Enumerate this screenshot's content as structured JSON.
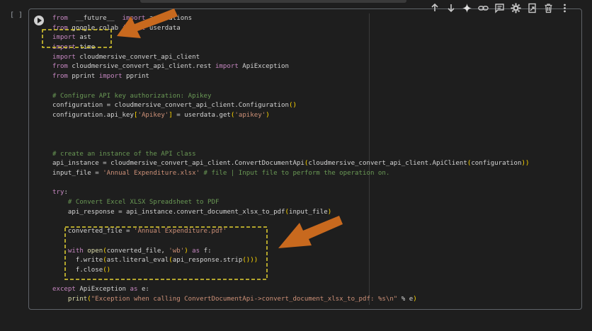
{
  "cell": {
    "execution_count": "[ ]",
    "lines": [
      [
        [
          "kw",
          "from"
        ],
        [
          "",
          "  __future__  "
        ],
        [
          "kw",
          "import"
        ],
        [
          "",
          " annotations"
        ]
      ],
      [
        [
          "kw",
          "from"
        ],
        [
          "",
          " google.colab "
        ],
        [
          "kw",
          "import"
        ],
        [
          "",
          " userdata"
        ]
      ],
      [
        [
          "kw",
          "import"
        ],
        [
          "",
          " ast"
        ]
      ],
      [
        [
          "kw",
          "import"
        ],
        [
          "",
          " time"
        ]
      ],
      [
        [
          "kw",
          "import"
        ],
        [
          "",
          " cloudmersive_convert_api_client"
        ]
      ],
      [
        [
          "kw",
          "from"
        ],
        [
          "",
          " cloudmersive_convert_api_client.rest "
        ],
        [
          "kw",
          "import"
        ],
        [
          "",
          " ApiException"
        ]
      ],
      [
        [
          "kw",
          "from"
        ],
        [
          "",
          " pprint "
        ],
        [
          "kw",
          "import"
        ],
        [
          "",
          " pprint"
        ]
      ],
      [],
      [
        [
          "cm",
          "# Configure API key authorization: Apikey"
        ]
      ],
      [
        [
          "",
          "configuration = cloudmersive_convert_api_client.Configuration"
        ],
        [
          "br",
          "()"
        ]
      ],
      [
        [
          "",
          "configuration.api_key"
        ],
        [
          "br",
          "["
        ],
        [
          "str",
          "'Apikey'"
        ],
        [
          "br",
          "]"
        ],
        [
          "",
          " = userdata.get"
        ],
        [
          "br",
          "("
        ],
        [
          "str",
          "'apikey'"
        ],
        [
          "br",
          ")"
        ]
      ],
      [],
      [],
      [],
      [
        [
          "cm",
          "# create an instance of the API class"
        ]
      ],
      [
        [
          "",
          "api_instance = cloudmersive_convert_api_client.ConvertDocumentApi"
        ],
        [
          "br",
          "("
        ],
        [
          "",
          "cloudmersive_convert_api_client.ApiClient"
        ],
        [
          "br",
          "("
        ],
        [
          "",
          "configuration"
        ],
        [
          "br",
          "))"
        ]
      ],
      [
        [
          "",
          "input_file = "
        ],
        [
          "str",
          "'Annual Expenditure.xlsx'"
        ],
        [
          "cm",
          " # file | Input file to perform the operation on."
        ]
      ],
      [],
      [
        [
          "kw",
          "try"
        ],
        [
          "",
          ":"
        ]
      ],
      [
        [
          "",
          "    "
        ],
        [
          "cm",
          "# Convert Excel XLSX Spreadsheet to PDF"
        ]
      ],
      [
        [
          "",
          "    api_response = api_instance.convert_document_xlsx_to_pdf"
        ],
        [
          "br",
          "("
        ],
        [
          "",
          "input_file"
        ],
        [
          "br",
          ")"
        ]
      ],
      [],
      [
        [
          "",
          "    converted_file = "
        ],
        [
          "str",
          "'Annual Expenditure.pdf'"
        ]
      ],
      [],
      [
        [
          "",
          "    "
        ],
        [
          "kw",
          "with"
        ],
        [
          "",
          " "
        ],
        [
          "fn",
          "open"
        ],
        [
          "br",
          "("
        ],
        [
          "",
          "converted_file, "
        ],
        [
          "str",
          "'wb'"
        ],
        [
          "br",
          ")"
        ],
        [
          "",
          " "
        ],
        [
          "kw",
          "as"
        ],
        [
          "",
          " f:"
        ]
      ],
      [
        [
          "",
          "      f.write"
        ],
        [
          "br",
          "("
        ],
        [
          "",
          "ast.literal_eval"
        ],
        [
          "br",
          "("
        ],
        [
          "",
          "api_response.strip"
        ],
        [
          "br",
          "()))"
        ]
      ],
      [
        [
          "",
          "      f.close"
        ],
        [
          "br",
          "()"
        ]
      ],
      [],
      [
        [
          "kw",
          "except"
        ],
        [
          "",
          " ApiException "
        ],
        [
          "kw",
          "as"
        ],
        [
          "",
          " e:"
        ]
      ],
      [
        [
          "",
          "    "
        ],
        [
          "fn",
          "print"
        ],
        [
          "br",
          "("
        ],
        [
          "str",
          "\"Exception when calling ConvertDocumentApi->convert_document_xlsx_to_pdf: %s\\n\""
        ],
        [
          "",
          " % e"
        ],
        [
          "br",
          ")"
        ]
      ]
    ]
  },
  "toolbar": {
    "icons": [
      "arrow-up-icon",
      "arrow-down-icon",
      "sparkle-icon",
      "link-icon",
      "comment-icon",
      "gear-icon",
      "mirror-cell-icon",
      "delete-icon",
      "more-vert-icon"
    ]
  },
  "colors": {
    "background": "#1e1e1e",
    "keyword": "#c586c0",
    "string": "#ce9178",
    "comment": "#6a9955",
    "bracket": "#ffd700",
    "annotation_arrow": "#c8691e",
    "annotation_box": "#e3d230"
  }
}
